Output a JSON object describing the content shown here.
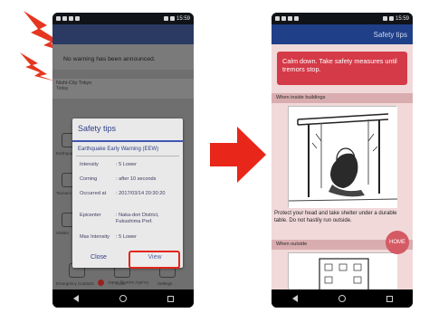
{
  "left_phone": {
    "status_time": "15:59",
    "warning_text": "No warning has been announced.",
    "location_label": "Nishi-City Tokyo",
    "location_sub": "Today",
    "bg_labels": [
      "Earthquake",
      "Typhoon",
      "Heavy rain",
      "Tsunami",
      "Volcano",
      "Shelter",
      "Emergency Contacts",
      "Links",
      "Settings"
    ],
    "brand": "Japan Tourism Agency",
    "dialog": {
      "title": "Safety tips",
      "subtitle": "Earthquake Early Warning (EEW)",
      "rows": [
        {
          "key": "Intensity",
          "value": ": 5 Lower"
        },
        {
          "key": "Coming",
          "value": ": after 10 seconds"
        },
        {
          "key": "Occurred at",
          "value": ": 2017/03/14 20:30:20"
        },
        {
          "key": "Epicenter",
          "value": ": Naka-dori District, Fukushima Pref."
        },
        {
          "key": "Max Intensity",
          "value": ": 5 Lower"
        }
      ],
      "close_label": "Close",
      "view_label": "View"
    },
    "highlight_color": "#e3261a"
  },
  "right_phone": {
    "status_time": "15:59",
    "appbar_title": "Safety tips",
    "calm_message": "Calm down. Take safety measures until tremors stop.",
    "section_inside": "When inside buildings",
    "shelter_text": "Protect your head and take shelter under a durable table. Do not hastily run outside.",
    "section_outside": "When outside",
    "home_label": "HOME",
    "accent_color": "#d53a48"
  },
  "arrow_color": "#e8261a",
  "bolt_color": "#e5361f"
}
